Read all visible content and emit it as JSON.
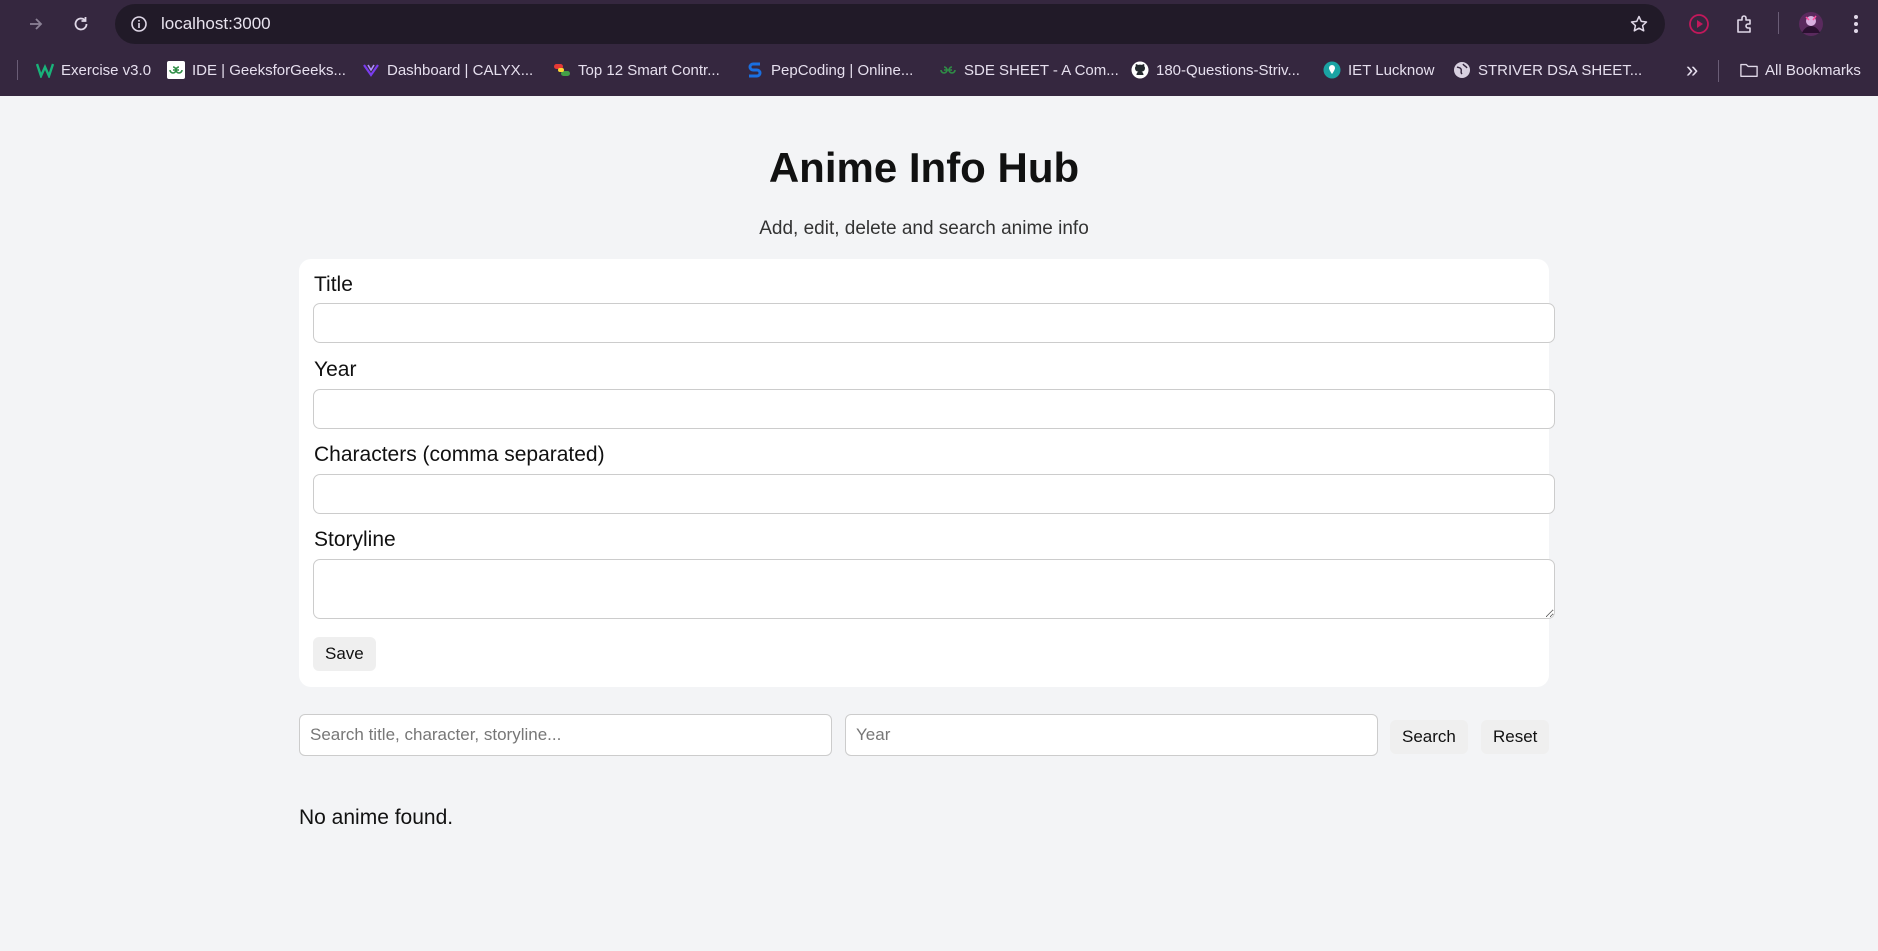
{
  "browser": {
    "url": "localhost:3000",
    "bookmarks": [
      {
        "label": "Exercise v3.0",
        "icon": "w-logo-icon"
      },
      {
        "label": "IDE | GeeksforGeeks...",
        "icon": "gfg-icon"
      },
      {
        "label": "Dashboard | CALYX...",
        "icon": "calyx-icon"
      },
      {
        "label": "Top 12 Smart Contr...",
        "icon": "pills-icon"
      },
      {
        "label": "PepCoding | Online...",
        "icon": "pepcoding-icon"
      },
      {
        "label": "SDE SHEET - A Com...",
        "icon": "gfg-icon"
      },
      {
        "label": "180-Questions-Striv...",
        "icon": "github-icon"
      },
      {
        "label": "IET Lucknow",
        "icon": "iet-icon"
      },
      {
        "label": "STRIVER DSA SHEET...",
        "icon": "globe-icon"
      }
    ],
    "more_label": "»",
    "all_bookmarks_label": "All Bookmarks"
  },
  "page": {
    "title": "Anime Info Hub",
    "subtitle": "Add, edit, delete and search anime info"
  },
  "form": {
    "title_label": "Title",
    "year_label": "Year",
    "characters_label": "Characters (comma separated)",
    "storyline_label": "Storyline",
    "title_value": "",
    "year_value": "",
    "characters_value": "",
    "storyline_value": "",
    "save_label": "Save"
  },
  "search": {
    "query_placeholder": "Search title, character, storyline...",
    "year_placeholder": "Year",
    "search_label": "Search",
    "reset_label": "Reset"
  },
  "results": {
    "empty_message": "No anime found."
  }
}
